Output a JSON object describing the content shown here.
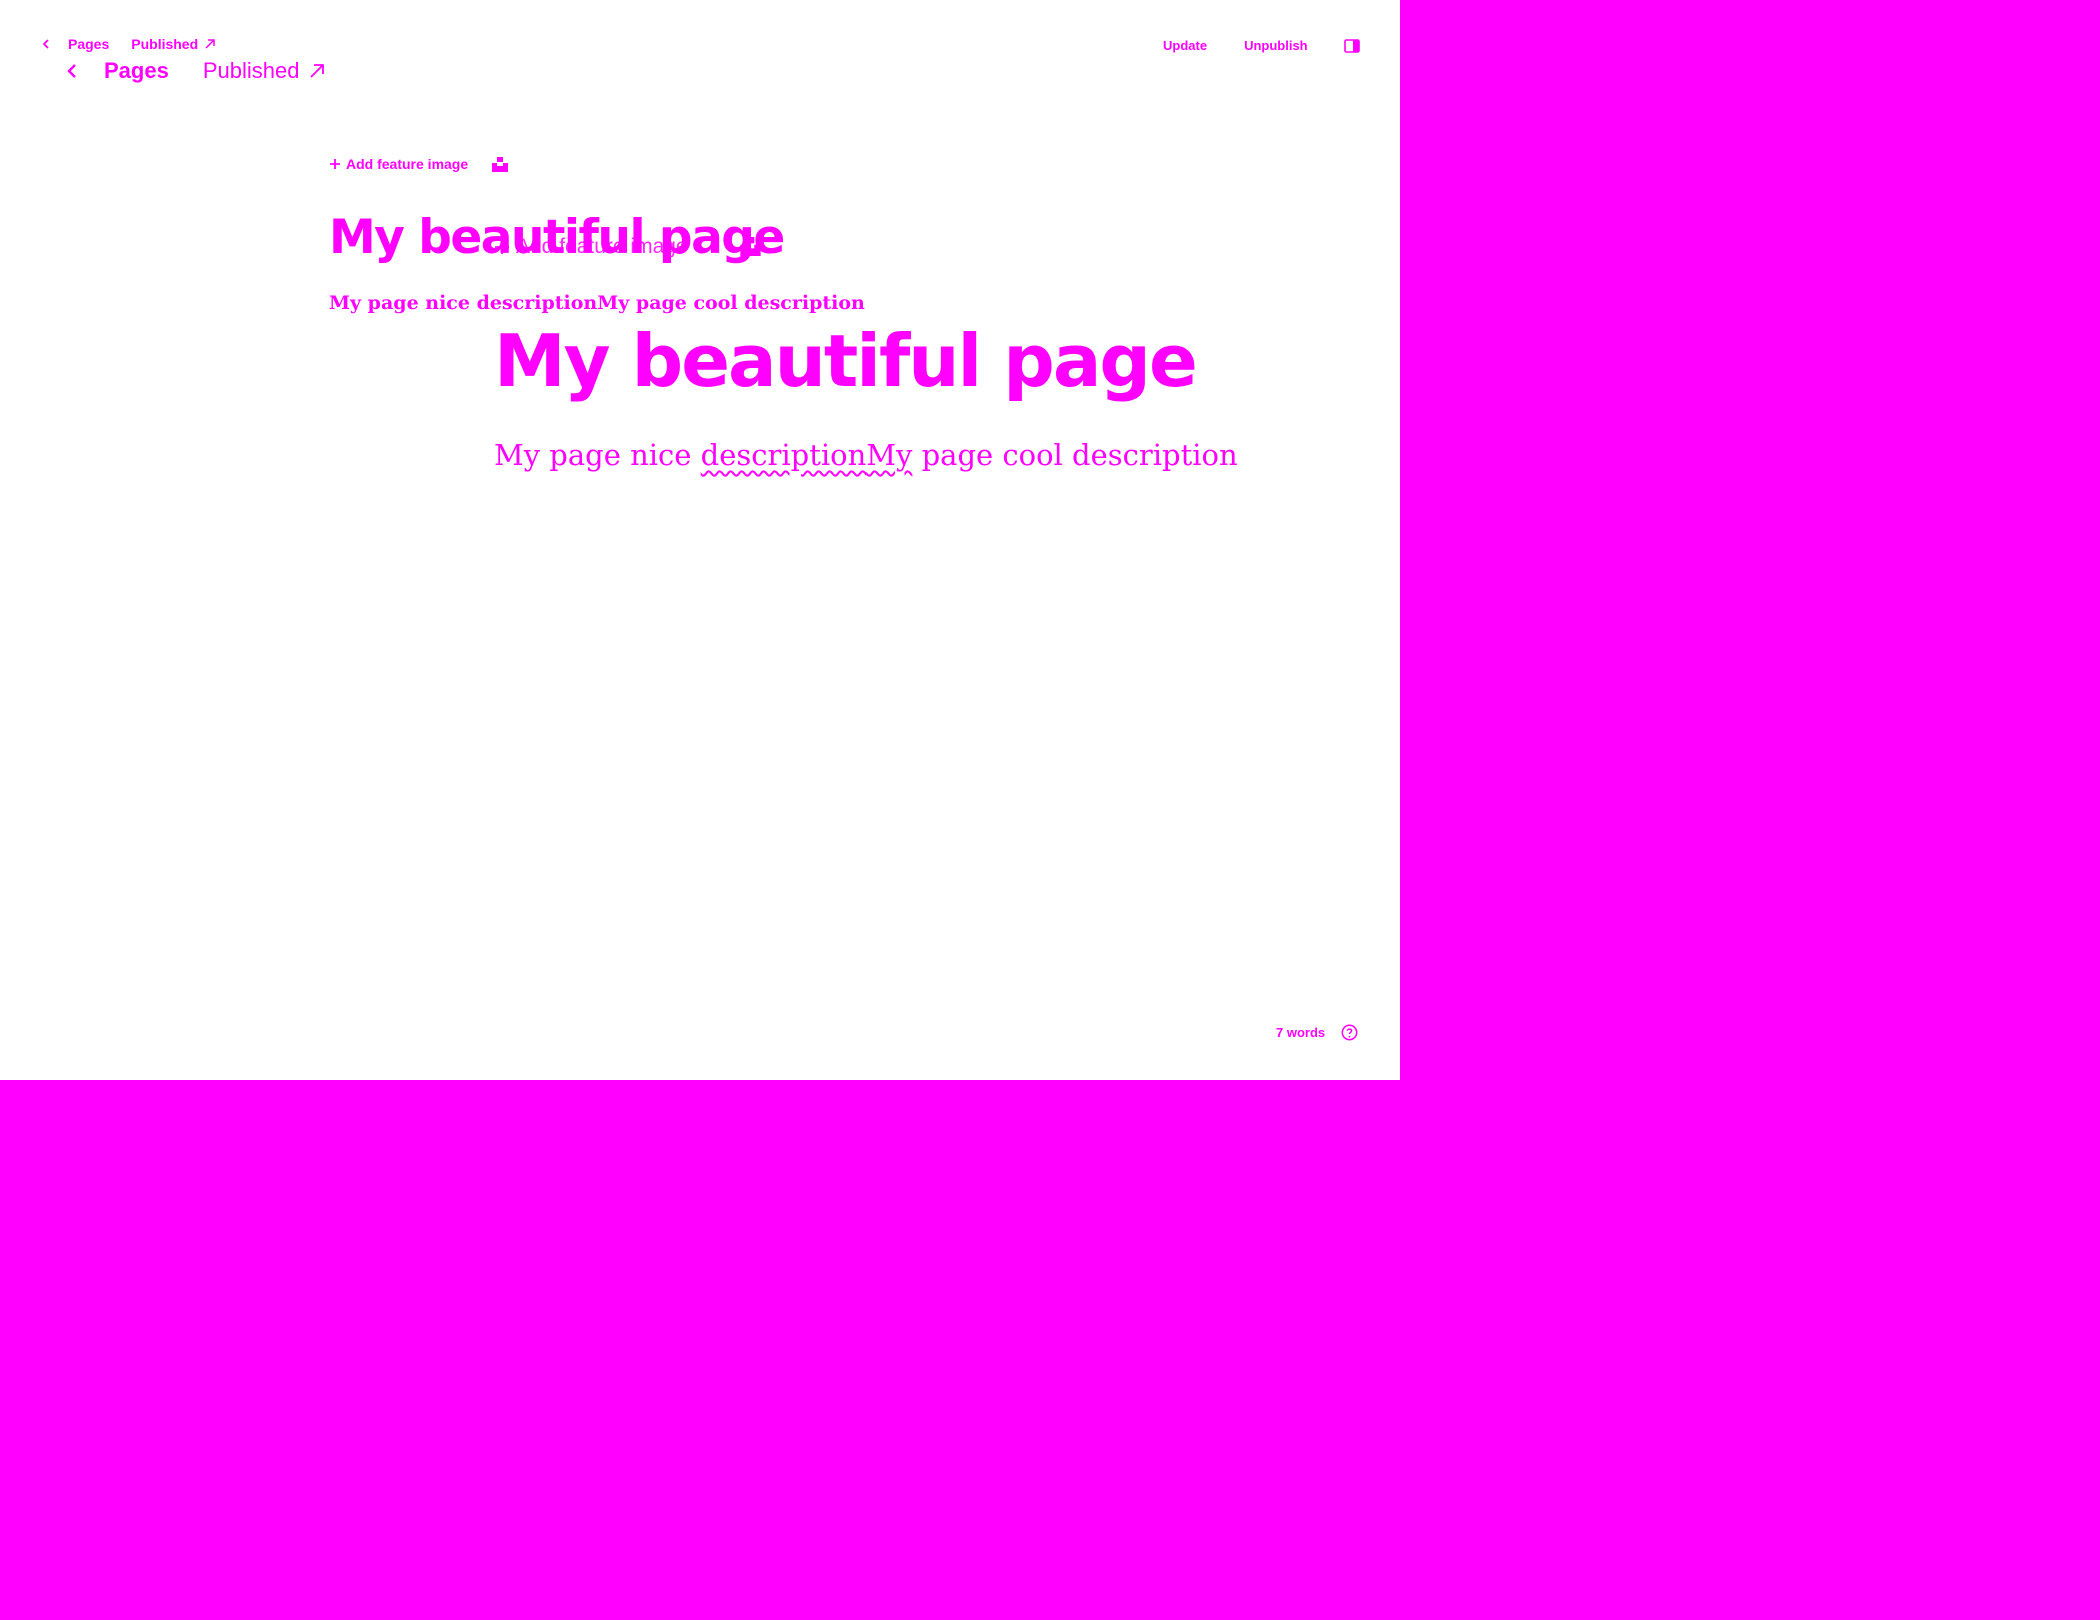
{
  "colors": {
    "accent": "#ff00ff",
    "editor_bg": "#ffffff"
  },
  "header": {
    "back_icon": "chevron-left-icon",
    "breadcrumb": "Pages",
    "status": "Published",
    "status_icon": "arrow-up-right-icon",
    "actions": {
      "update": "Update",
      "unpublish": "Unpublish"
    },
    "settings_icon": "sidebar-toggle-icon"
  },
  "feature_image": {
    "label": "Add feature image",
    "icon": "plus-icon",
    "unsplash_icon": "unsplash-icon"
  },
  "page": {
    "title": "My beautiful page",
    "excerpt_a": "My page nice description",
    "excerpt_b": "My page cool description"
  },
  "footer": {
    "word_count": "7 words",
    "help_icon": "help-circle-icon"
  }
}
